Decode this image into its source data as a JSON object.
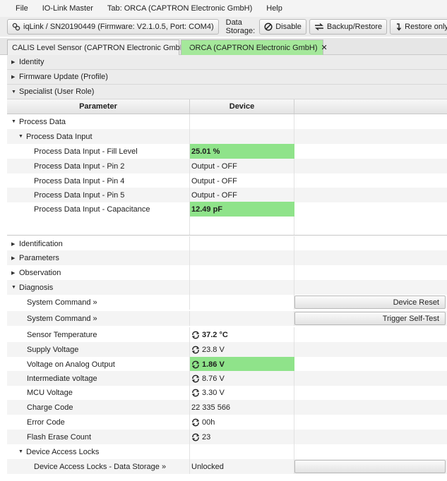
{
  "menubar": {
    "items": [
      "File",
      "IO-Link Master",
      "Tab: ORCA (CAPTRON Electronic GmbH)",
      "Help"
    ]
  },
  "toolbar": {
    "device_button": "iqLink / SN20190449 (Firmware: V2.1.0.5, Port: COM4)",
    "data_storage_label": "Data Storage:",
    "disable_button": "Disable",
    "backup_restore_button": "Backup/Restore",
    "restore_only_button": "Restore only"
  },
  "tabs": [
    {
      "label": "CALIS Level Sensor (CAPTRON Electronic GmbH)",
      "close": "✕",
      "active": false
    },
    {
      "label": "ORCA (CAPTRON Electronic GmbH)",
      "close": "✕",
      "active": true
    }
  ],
  "sections": {
    "identity": "Identity",
    "firmware_update": "Firmware Update (Profile)",
    "specialist": "Specialist (User Role)"
  },
  "table": {
    "col_parameter": "Parameter",
    "col_device": "Device"
  },
  "process_data": {
    "group": "Process Data",
    "subgroup": "Process Data Input",
    "rows": [
      {
        "name": "Process Data Input - Fill Level",
        "value": "25.01 %"
      },
      {
        "name": "Process Data Input - Pin 2",
        "value": "Output - OFF"
      },
      {
        "name": "Process Data Input - Pin 4",
        "value": "Output - OFF"
      },
      {
        "name": "Process Data Input - Pin 5",
        "value": "Output - OFF"
      },
      {
        "name": "Process Data Input - Capacitance",
        "value": "12.49 pF"
      }
    ]
  },
  "tree": {
    "identification": "Identification",
    "parameters": "Parameters",
    "observation": "Observation",
    "diagnosis": "Diagnosis"
  },
  "diagnosis": {
    "system_command_1": "System Command »",
    "device_reset_button": "Device Reset",
    "system_command_2": "System Command »",
    "trigger_self_test_button": "Trigger Self-Test",
    "rows": [
      {
        "name": "Sensor Temperature",
        "value": "37.2 °C"
      },
      {
        "name": "Supply Voltage",
        "value": "23.8 V"
      },
      {
        "name": "Voltage on Analog Output",
        "value": "1.86 V"
      },
      {
        "name": "Intermediate voltage",
        "value": "8.76 V"
      },
      {
        "name": "MCU Voltage",
        "value": "3.30 V"
      },
      {
        "name": "Charge Code",
        "value": "22 335 566"
      },
      {
        "name": "Error Code",
        "value": "00h"
      },
      {
        "name": "Flash Erase Count",
        "value": "23"
      }
    ],
    "device_access_locks": "Device Access Locks",
    "data_storage_lock_name": "Device Access Locks - Data Storage »",
    "data_storage_lock_value": "Unlocked"
  },
  "colors": {
    "highlight": "#8fe38a",
    "active_tab": "#a5e89b"
  }
}
